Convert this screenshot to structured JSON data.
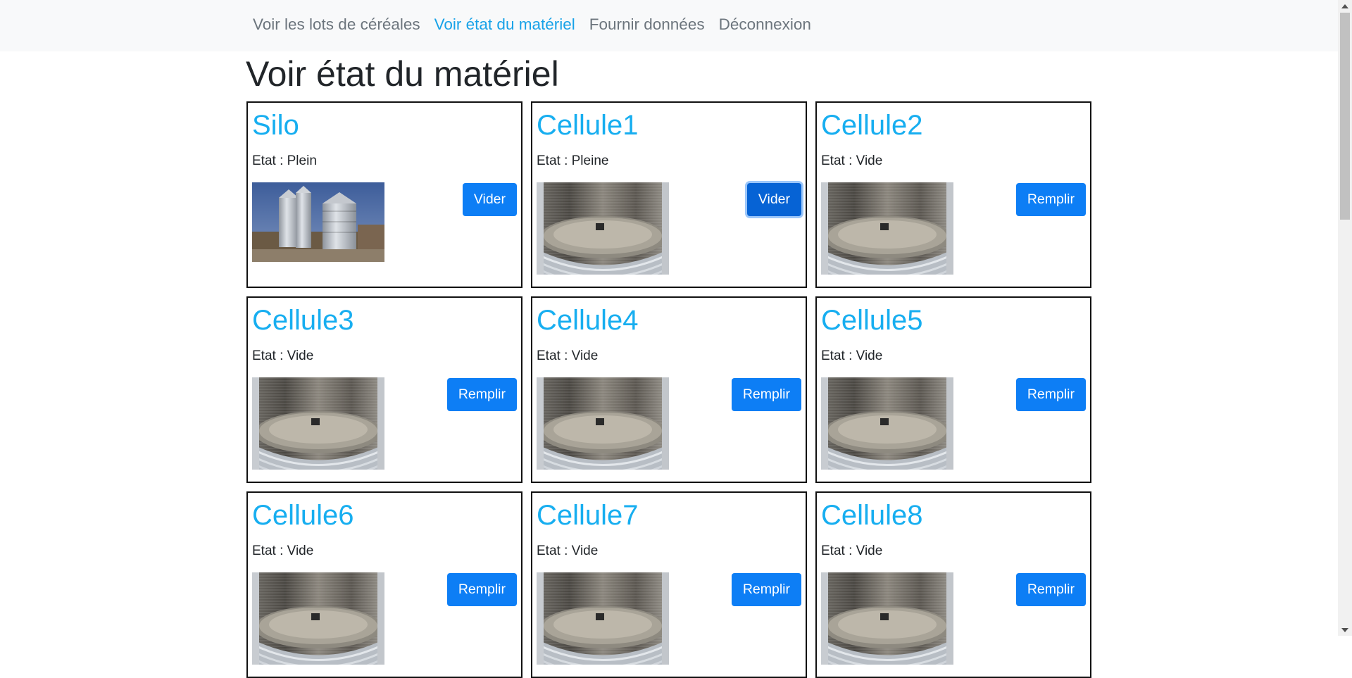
{
  "nav": {
    "items": [
      {
        "label": "Voir les lots de céréales",
        "active": false
      },
      {
        "label": "Voir état du matériel",
        "active": true
      },
      {
        "label": "Fournir données",
        "active": false
      },
      {
        "label": "Déconnexion",
        "active": false
      }
    ]
  },
  "page": {
    "title": "Voir état du matériel"
  },
  "colors": {
    "accent": "#17aef0",
    "button": "#0d7ef5",
    "nav_bg": "#f8f9fa"
  },
  "cards": [
    {
      "name": "Silo",
      "status": "Etat : Plein",
      "button": "Vider",
      "image": "silo-photo"
    },
    {
      "name": "Cellule1",
      "status": "Etat : Pleine",
      "button": "Vider",
      "image": "cellule-photo"
    },
    {
      "name": "Cellule2",
      "status": "Etat : Vide",
      "button": "Remplir",
      "image": "cellule-photo"
    },
    {
      "name": "Cellule3",
      "status": "Etat : Vide",
      "button": "Remplir",
      "image": "cellule-photo"
    },
    {
      "name": "Cellule4",
      "status": "Etat : Vide",
      "button": "Remplir",
      "image": "cellule-photo"
    },
    {
      "name": "Cellule5",
      "status": "Etat : Vide",
      "button": "Remplir",
      "image": "cellule-photo"
    },
    {
      "name": "Cellule6",
      "status": "Etat : Vide",
      "button": "Remplir",
      "image": "cellule-photo"
    },
    {
      "name": "Cellule7",
      "status": "Etat : Vide",
      "button": "Remplir",
      "image": "cellule-photo"
    },
    {
      "name": "Cellule8",
      "status": "Etat : Vide",
      "button": "Remplir",
      "image": "cellule-photo"
    }
  ]
}
